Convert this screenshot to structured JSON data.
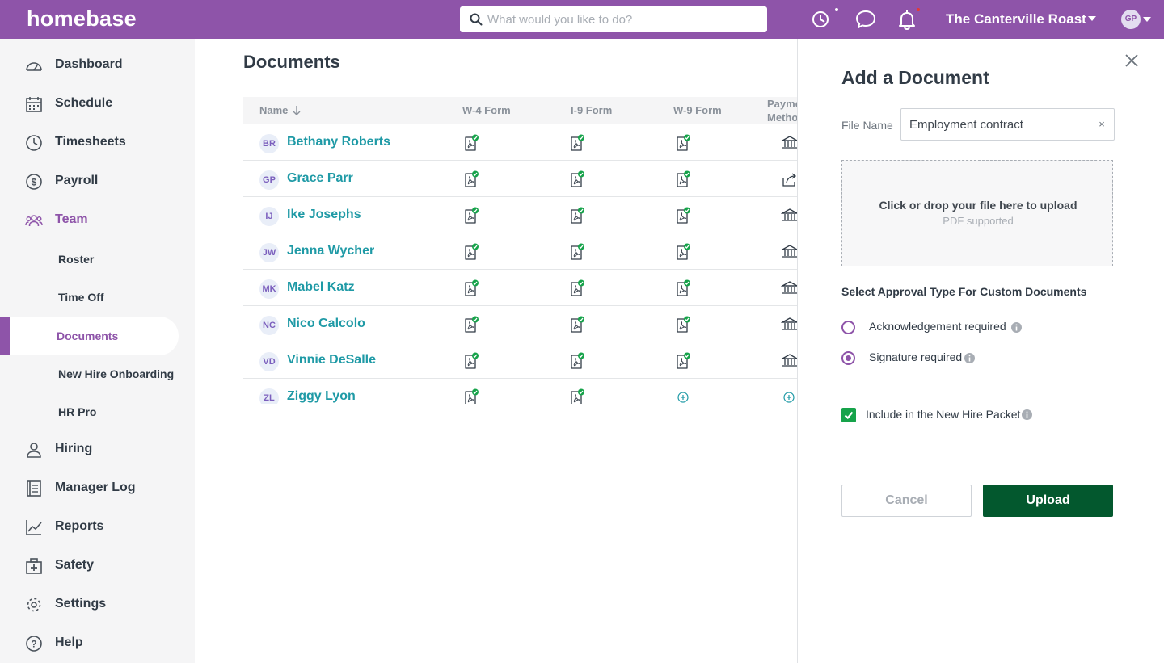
{
  "brand": {
    "name": "homebase",
    "accent": "#8e54a9",
    "link": "#1f9aa6",
    "success": "#16a34a",
    "primary_button": "#03582e"
  },
  "topbar": {
    "search_placeholder": "What would you like to do?",
    "location": "The Canterville Roast",
    "avatar_initials": "GP",
    "icons": [
      "clock-icon",
      "chat-icon",
      "bell-icon"
    ]
  },
  "sidebar": {
    "items": [
      {
        "label": "Dashboard",
        "icon": "dashboard-icon"
      },
      {
        "label": "Schedule",
        "icon": "calendar-icon"
      },
      {
        "label": "Timesheets",
        "icon": "clock-icon"
      },
      {
        "label": "Payroll",
        "icon": "dollar-icon"
      },
      {
        "label": "Team",
        "icon": "team-icon",
        "active": true
      },
      {
        "label": "Hiring",
        "icon": "person-icon"
      },
      {
        "label": "Manager Log",
        "icon": "book-icon"
      },
      {
        "label": "Reports",
        "icon": "chart-icon"
      },
      {
        "label": "Safety",
        "icon": "first-aid-icon"
      },
      {
        "label": "Settings",
        "icon": "gear-icon"
      },
      {
        "label": "Help",
        "icon": "help-icon"
      }
    ],
    "team_sub": [
      {
        "label": "Roster"
      },
      {
        "label": "Time Off"
      },
      {
        "label": "Documents",
        "current": true
      },
      {
        "label": "New Hire Onboarding"
      },
      {
        "label": "HR Pro"
      }
    ]
  },
  "main": {
    "title": "Documents",
    "columns": [
      "Name",
      "W-4 Form",
      "I-9 Form",
      "W-9 Form",
      "Payment Method"
    ],
    "rows": [
      {
        "initials": "BR",
        "name": "Bethany Roberts",
        "w4": "complete",
        "i9": "complete",
        "w9": "complete",
        "payment": "bank"
      },
      {
        "initials": "GP",
        "name": "Grace Parr",
        "w4": "complete",
        "i9": "complete",
        "w9": "complete",
        "payment": "share"
      },
      {
        "initials": "IJ",
        "name": "Ike Josephs",
        "w4": "complete",
        "i9": "complete",
        "w9": "complete",
        "payment": "bank"
      },
      {
        "initials": "JW",
        "name": "Jenna Wycher",
        "w4": "complete",
        "i9": "complete",
        "w9": "complete",
        "payment": "bank"
      },
      {
        "initials": "MK",
        "name": "Mabel Katz",
        "w4": "complete",
        "i9": "complete",
        "w9": "complete",
        "payment": "bank"
      },
      {
        "initials": "NC",
        "name": "Nico Calcolo",
        "w4": "complete",
        "i9": "complete",
        "w9": "complete",
        "payment": "bank"
      },
      {
        "initials": "VD",
        "name": "Vinnie DeSalle",
        "w4": "complete",
        "i9": "complete",
        "w9": "complete",
        "payment": "bank"
      },
      {
        "initials": "ZL",
        "name": "Ziggy Lyon",
        "w4": "complete",
        "i9": "complete",
        "w9": "add",
        "payment": "add"
      }
    ]
  },
  "panel": {
    "title": "Add a Document",
    "file_name_label": "File Name",
    "file_name_value": "Employment contract",
    "clear_glyph": "×",
    "dropzone_main": "Click or drop your file here to upload",
    "dropzone_sub": "PDF supported",
    "approval_title": "Select Approval Type For Custom Documents",
    "options": [
      {
        "label": "Acknowledgement required",
        "selected": false
      },
      {
        "label": "Signature required",
        "selected": true
      }
    ],
    "include_label": "Include in the New Hire Packet",
    "include_checked": true,
    "cancel_label": "Cancel",
    "upload_label": "Upload"
  }
}
